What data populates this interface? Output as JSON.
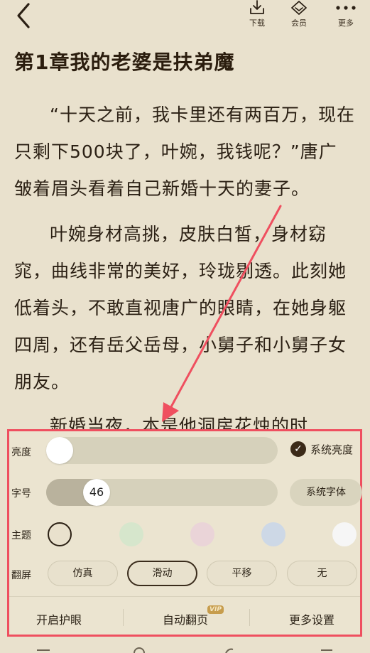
{
  "toolbar": {
    "download_label": "下载",
    "vip_label": "会员",
    "more_label": "更多"
  },
  "chapter": {
    "title": "第1章我的老婆是扶弟魔",
    "paragraphs": [
      "“十天之前，我卡里还有两百万，现在只剩下500块了，叶婉，我钱呢？”唐广皱着眉头看着自己新婚十天的妻子。",
      "叶婉身材高挑，皮肤白皙，身材窈窕，曲线非常的美好，玲珑剔透。此刻她低着头，不敢直视唐广的眼睛，在她身躯四周，还有岳父岳母，小舅子和小舅子女朋友。",
      "新婚当夜，本是他洞房花烛的时"
    ]
  },
  "settings": {
    "brightness": {
      "label": "亮度",
      "system_label": "系统亮度",
      "system_checked": true,
      "level": 0.0
    },
    "font_size": {
      "label": "字号",
      "value": "46",
      "system_font_label": "系统字体",
      "level": 0.2
    },
    "theme": {
      "label": "主题",
      "colors": [
        "#e9e1cd",
        "#d6e6cc",
        "#ead4d8",
        "#cdd8e6",
        "#f6f6f6"
      ],
      "selected_index": 0
    },
    "page_flip": {
      "label": "翻屏",
      "options": [
        "仿真",
        "滑动",
        "平移",
        "无"
      ],
      "selected_index": 1
    },
    "bottom": {
      "eye_protect": "开启护眼",
      "auto_flip": "自动翻页",
      "vip_badge": "VIP",
      "more_settings": "更多设置"
    }
  },
  "colors": {
    "annotation": "#ef4f5f",
    "accent": "#3b2a18"
  }
}
